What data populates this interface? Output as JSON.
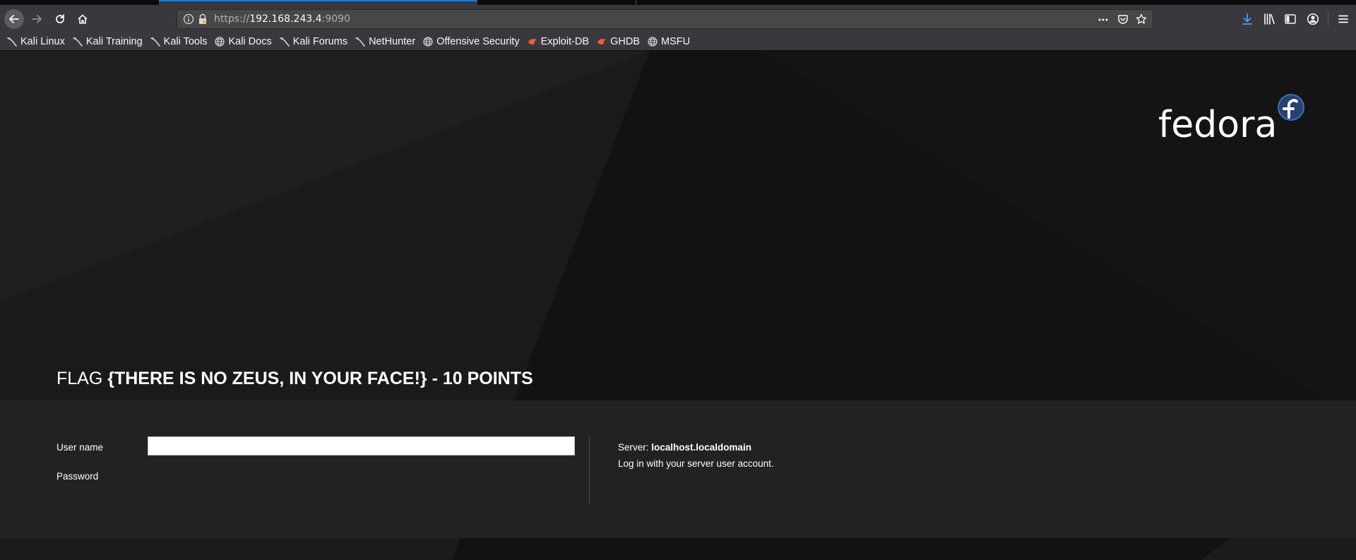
{
  "browser": {
    "url": {
      "scheme": "https://",
      "host": "192.168.243.4",
      "port": ":9090"
    },
    "bookmarks": [
      {
        "label": "Kali Linux",
        "icon": "kali-dragon-icon"
      },
      {
        "label": "Kali Training",
        "icon": "kali-dragon-icon"
      },
      {
        "label": "Kali Tools",
        "icon": "kali-dragon-icon"
      },
      {
        "label": "Kali Docs",
        "icon": "globe-icon"
      },
      {
        "label": "Kali Forums",
        "icon": "kali-dragon-icon"
      },
      {
        "label": "NetHunter",
        "icon": "kali-dragon-icon"
      },
      {
        "label": "Offensive Security",
        "icon": "globe-icon"
      },
      {
        "label": "Exploit-DB",
        "icon": "exploit-db-icon"
      },
      {
        "label": "GHDB",
        "icon": "exploit-db-icon"
      },
      {
        "label": "MSFU",
        "icon": "globe-icon"
      }
    ]
  },
  "page": {
    "brand": "fedora",
    "flag": {
      "prefix": "FLAG ",
      "text": "{THERE IS NO ZEUS, IN YOUR FACE!} - 10 POINTS"
    },
    "login": {
      "username_label": "User name",
      "username_value": "",
      "password_label": "Password",
      "server_label": "Server: ",
      "server_name": "localhost.localdomain",
      "hint": "Log in with your server user account."
    }
  },
  "colors": {
    "accent": "#0a84ff",
    "chrome_bg": "#38383d",
    "page_bg": "#121213",
    "panel_bg": "#222222",
    "fedora_blue": "#294172"
  }
}
